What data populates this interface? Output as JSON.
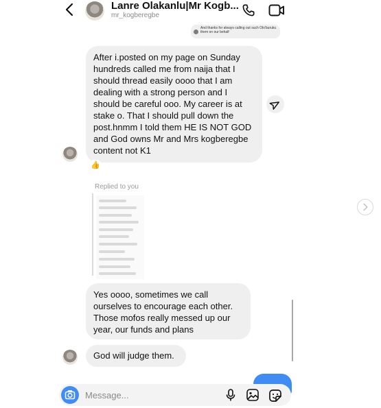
{
  "header": {
    "contact_name": "Lanre Olakanlu|Mr Kogb...",
    "username": "mr_kogberegbe"
  },
  "messages": {
    "top_small_text": "And thanks for always calling out such Olo'buruku them on our behalf",
    "incoming_1": "After i.posted on my page on Sunday hundreds called me from naija that I should thread easily oooo that I am dealing with a strong person and I should be careful ooo. My career is at stake o. That I should pull down the post.hnmm I told them HE IS NOT GOD and God owns Mr and Mrs kogberegbe content not K1",
    "reaction_emoji": "👍",
    "replied_label": "Replied to you",
    "incoming_2": "Yes oooo, sometimes we call ourselves to encourage each other. Those mofos really messed up our year, our funds and plans",
    "incoming_3": "God will judge them."
  },
  "composer": {
    "placeholder": "Message..."
  },
  "colors": {
    "accent": "#3f8cf5",
    "bubble": "#efefef"
  },
  "icons": [
    "back-icon",
    "call-icon",
    "video-icon",
    "share-icon",
    "camera-icon",
    "mic-icon",
    "gallery-icon",
    "sticker-icon",
    "next-icon"
  ]
}
